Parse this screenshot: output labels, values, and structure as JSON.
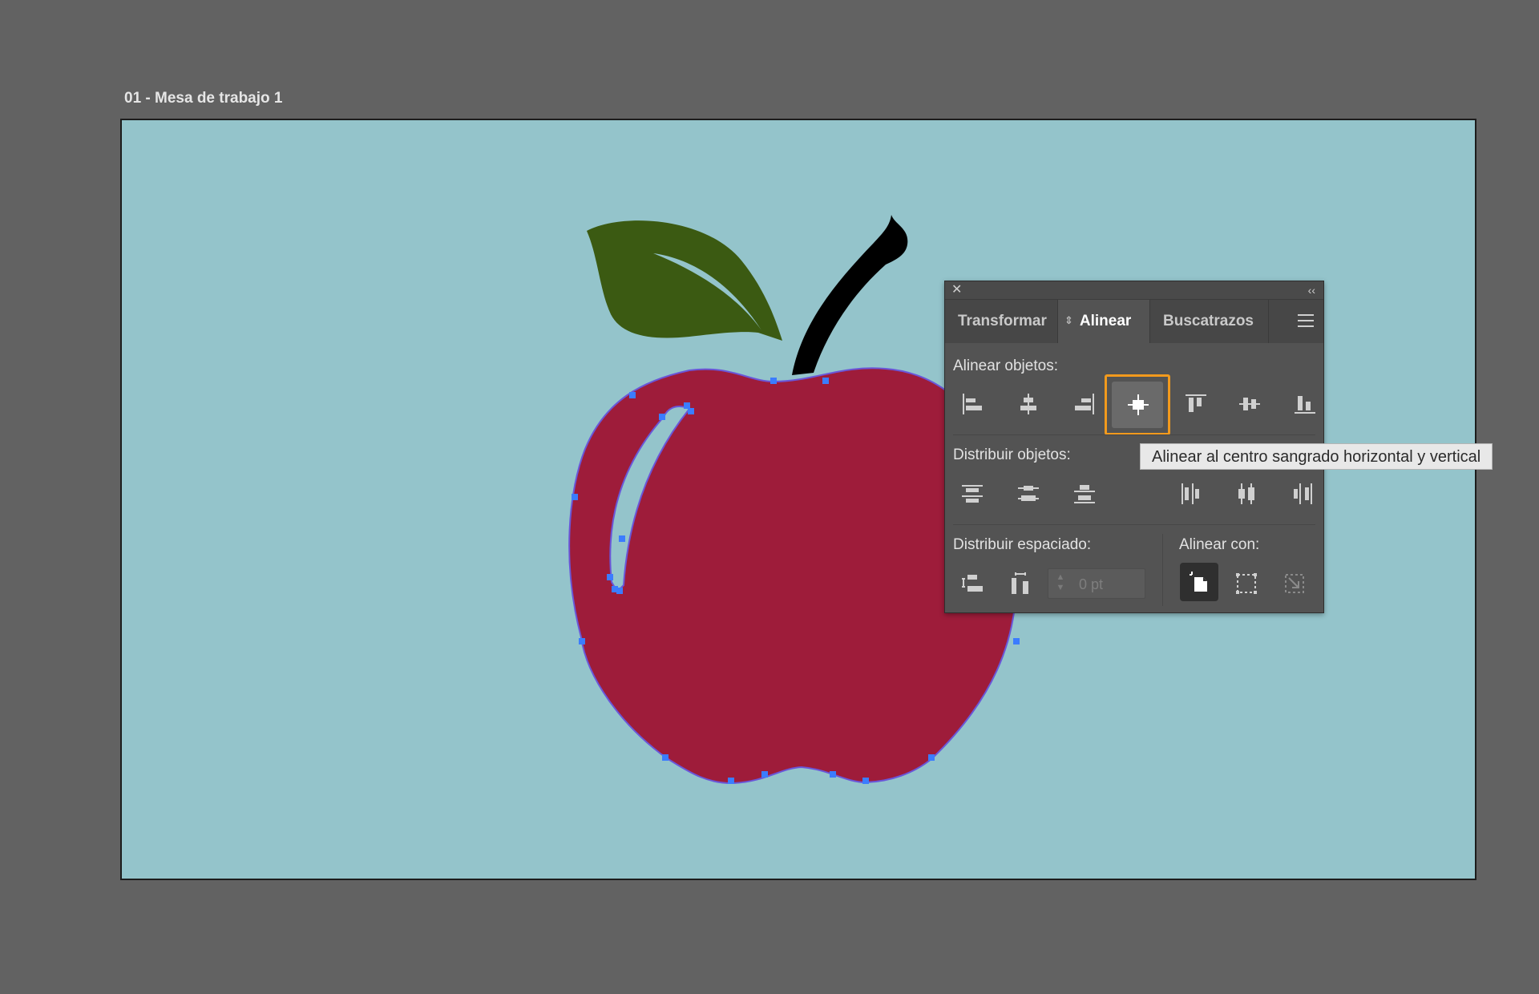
{
  "artboard": {
    "label": "01 - Mesa de trabajo 1",
    "background": "#94c4cb"
  },
  "artwork": {
    "apple_color": "#9e1c3a",
    "leaf_color": "#3b5a12",
    "stem_color": "#000000",
    "anchor_color": "#3b7cff"
  },
  "panel": {
    "close_icon": "close-icon",
    "collapse_icon": "double-chevron-left-icon",
    "tabs": [
      {
        "label": "Transformar",
        "active": false
      },
      {
        "label": "Alinear",
        "active": true
      },
      {
        "label": "Buscatrazos",
        "active": false
      }
    ],
    "menu_icon": "hamburger-menu-icon",
    "align_objects_label": "Alinear objetos:",
    "distribute_objects_label": "Distribuir objetos:",
    "distribute_spacing_label": "Distribuir espaciado:",
    "align_to_label": "Alinear con:",
    "spacing_value": "0 pt",
    "align_objects_buttons": [
      "align-left-icon",
      "align-horizontal-center-icon",
      "align-right-icon",
      "align-center-bleed-icon",
      "align-top-icon",
      "align-vertical-center-icon",
      "align-bottom-icon"
    ],
    "distribute_objects_buttons": [
      "distribute-top-icon",
      "distribute-vertical-center-icon",
      "distribute-bottom-icon",
      "distribute-left-icon",
      "distribute-horizontal-center-icon",
      "distribute-right-icon"
    ],
    "distribute_spacing_buttons": [
      "vertical-distribute-space-icon",
      "horizontal-distribute-space-icon"
    ],
    "align_to_buttons": [
      "align-to-artboard-icon",
      "align-to-selection-icon",
      "align-to-key-object-icon"
    ],
    "highlight_color": "#f29a1d"
  },
  "tooltip": {
    "text": "Alinear al centro sangrado horizontal y vertical"
  }
}
